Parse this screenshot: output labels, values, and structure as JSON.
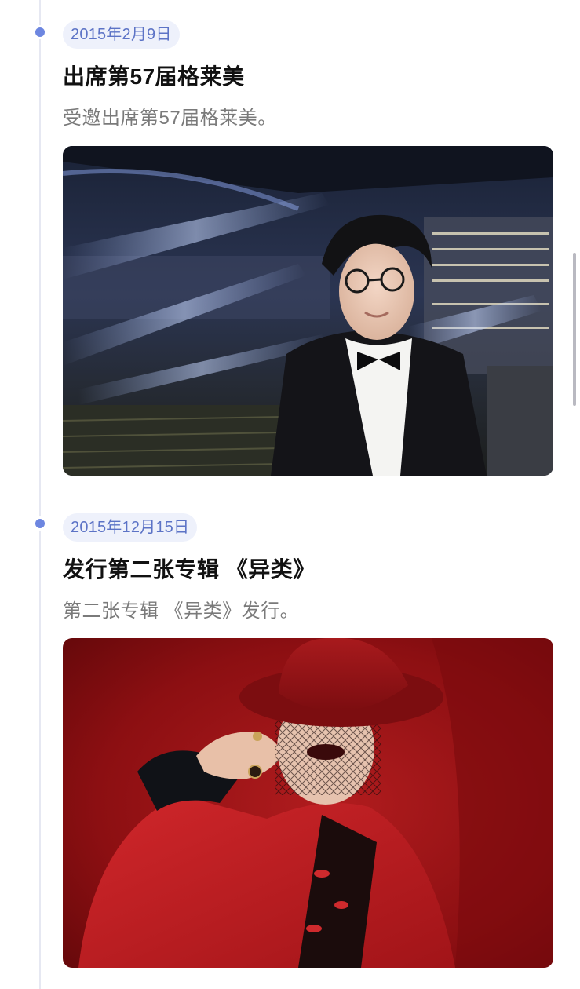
{
  "timeline": {
    "entries": [
      {
        "date": "2015年2月9日",
        "title": "出席第57届格莱美",
        "description": "受邀出席第57届格莱美。",
        "photo_icon": "arena-portrait-photo"
      },
      {
        "date": "2015年12月15日",
        "title": "发行第二张专辑 《异类》",
        "description": "第二张专辑 《异类》发行。",
        "photo_icon": "red-portrait-photo"
      }
    ]
  },
  "colors": {
    "accent": "#6d86e0",
    "date_text": "#5c73c6",
    "date_bg": "#eef1fb",
    "title": "#111111",
    "description": "#7a7a7a",
    "timeline_line": "#e6e8f2"
  }
}
